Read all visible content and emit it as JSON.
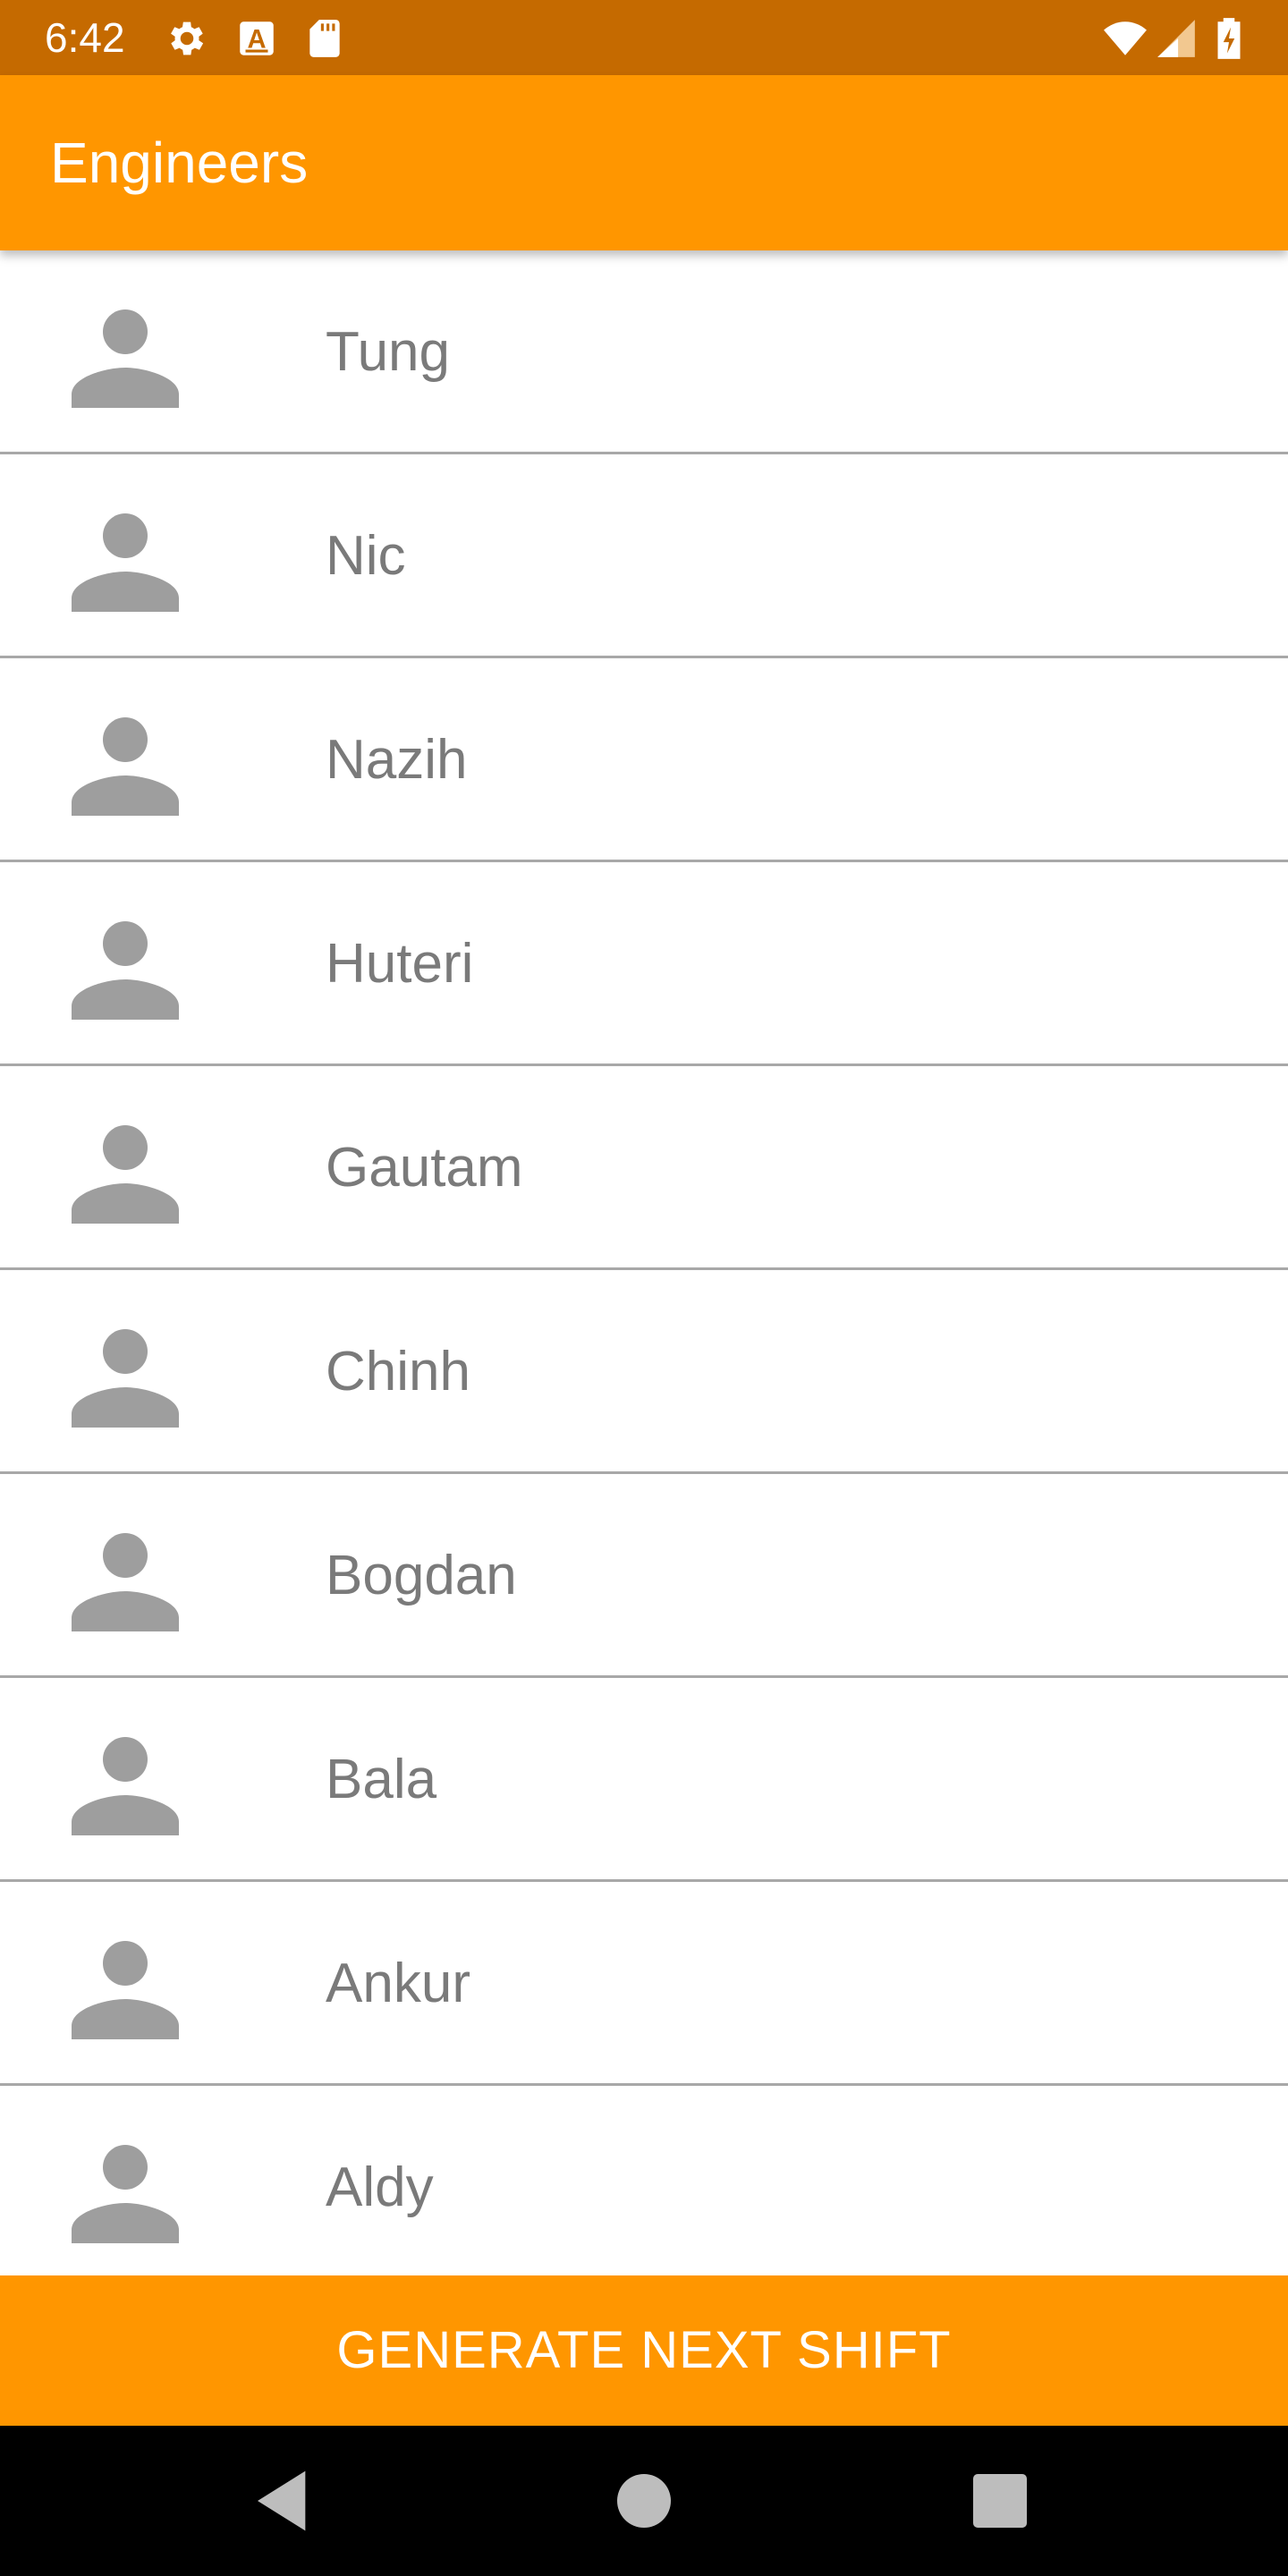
{
  "status_bar": {
    "time": "6:42",
    "background_color": "#C56A00",
    "left_icons": [
      "gear-icon",
      "a-box-icon",
      "sd-card-icon"
    ],
    "right_icons": [
      "wifi-icon",
      "cell-signal-icon",
      "battery-charging-icon"
    ]
  },
  "app_bar": {
    "title": "Engineers",
    "background_color": "#FF9600"
  },
  "engineers": [
    {
      "name": "Tung",
      "icon": "person-icon"
    },
    {
      "name": "Nic",
      "icon": "person-icon"
    },
    {
      "name": "Nazih",
      "icon": "person-icon"
    },
    {
      "name": "Huteri",
      "icon": "person-icon"
    },
    {
      "name": "Gautam",
      "icon": "person-icon"
    },
    {
      "name": "Chinh",
      "icon": "person-icon"
    },
    {
      "name": "Bogdan",
      "icon": "person-icon"
    },
    {
      "name": "Bala",
      "icon": "person-icon"
    },
    {
      "name": "Ankur",
      "icon": "person-icon"
    },
    {
      "name": "Aldy",
      "icon": "person-icon"
    }
  ],
  "generate_button": {
    "label": "GENERATE NEXT SHIFT",
    "background_color": "#FF9600"
  },
  "nav_bar": {
    "buttons": [
      "back-icon",
      "home-icon",
      "recents-icon"
    ]
  }
}
